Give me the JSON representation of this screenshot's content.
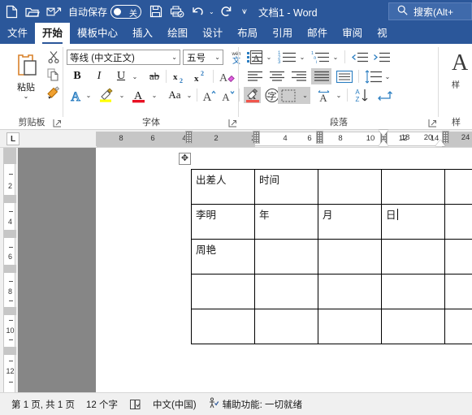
{
  "titlebar": {
    "quick_access": [
      {
        "name": "new-document-icon",
        "tip": "新建"
      },
      {
        "name": "open-folder-icon",
        "tip": "打开"
      },
      {
        "name": "email-attach-icon",
        "tip": "电子邮件"
      }
    ],
    "autosave_label": "自动保存",
    "autosave_state": "关",
    "quick_access_2": [
      {
        "name": "save-icon",
        "tip": "保存"
      },
      {
        "name": "print-preview-icon",
        "tip": "打印预览"
      },
      {
        "name": "undo-icon",
        "tip": "撤消"
      },
      {
        "name": "redo-icon",
        "tip": "恢复"
      },
      {
        "name": "customize-qat-icon",
        "tip": "自定义快速访问工具栏"
      }
    ],
    "document_title": "文档1  -  Word",
    "search_placeholder": "搜索(Alt+"
  },
  "tabs": [
    {
      "label": "文件",
      "active": false
    },
    {
      "label": "开始",
      "active": true
    },
    {
      "label": "模板中心",
      "active": false
    },
    {
      "label": "插入",
      "active": false
    },
    {
      "label": "绘图",
      "active": false
    },
    {
      "label": "设计",
      "active": false
    },
    {
      "label": "布局",
      "active": false
    },
    {
      "label": "引用",
      "active": false
    },
    {
      "label": "邮件",
      "active": false
    },
    {
      "label": "审阅",
      "active": false
    },
    {
      "label": "视",
      "active": false
    }
  ],
  "ribbon": {
    "clipboard": {
      "group_label": "剪贴板",
      "paste_label": "粘贴",
      "paste_caret": "⌄",
      "buttons": [
        {
          "name": "cut-button",
          "label": "剪切"
        },
        {
          "name": "copy-button",
          "label": "复制"
        },
        {
          "name": "format-painter-button",
          "label": "格式刷"
        }
      ]
    },
    "font": {
      "group_label": "字体",
      "font_name": "等线 (中文正文)",
      "font_size": "五号",
      "buttons": [
        {
          "name": "phonetic-guide-button",
          "label": "拼音指南"
        },
        {
          "name": "enclose-characters-button",
          "label": "字符边框"
        },
        {
          "name": "bold-button",
          "label": "B"
        },
        {
          "name": "italic-button",
          "label": "I"
        },
        {
          "name": "underline-button",
          "label": "U"
        },
        {
          "name": "strikethrough-button",
          "label": "ab"
        },
        {
          "name": "subscript-button",
          "label": "x₂"
        },
        {
          "name": "superscript-button",
          "label": "x²"
        },
        {
          "name": "clear-format-button",
          "label": "清除所有格式"
        },
        {
          "name": "text-effects-button",
          "label": "文本效果"
        },
        {
          "name": "highlight-color-button",
          "label": "突出显示"
        },
        {
          "name": "font-color-button",
          "label": "字体颜色"
        },
        {
          "name": "change-case-button",
          "label": "Aa"
        },
        {
          "name": "grow-font-button",
          "label": "增大字号"
        },
        {
          "name": "shrink-font-button",
          "label": "减小字号"
        },
        {
          "name": "character-shading-button",
          "label": "字符底纹"
        },
        {
          "name": "circle-character-button",
          "label": "带圈字符"
        }
      ]
    },
    "paragraph": {
      "group_label": "段落",
      "buttons": [
        {
          "name": "bullets-button",
          "label": "项目符号"
        },
        {
          "name": "numbering-button",
          "label": "编号"
        },
        {
          "name": "multilevel-list-button",
          "label": "多级列表"
        },
        {
          "name": "decrease-indent-button",
          "label": "减少缩进量"
        },
        {
          "name": "increase-indent-button",
          "label": "增加缩进量"
        },
        {
          "name": "align-left-button",
          "label": "左对齐"
        },
        {
          "name": "align-center-button",
          "label": "居中"
        },
        {
          "name": "align-right-button",
          "label": "右对齐"
        },
        {
          "name": "justify-button",
          "label": "两端对齐"
        },
        {
          "name": "distribute-button",
          "label": "分散对齐"
        },
        {
          "name": "line-spacing-button",
          "label": "行和段落间距"
        },
        {
          "name": "shading-button",
          "label": "底纹"
        },
        {
          "name": "borders-button",
          "label": "边框"
        },
        {
          "name": "adjust-list-indent-button",
          "label": "中文版式"
        },
        {
          "name": "sort-button",
          "label": "排序"
        },
        {
          "name": "show-marks-button",
          "label": "显示编辑标记"
        }
      ]
    },
    "styles": {
      "group_label": "样",
      "gallery_label": "样"
    }
  },
  "hruler": {
    "tab_stop_marker": "L",
    "numbers": [
      "8",
      "6",
      "4",
      "2",
      "2",
      "4",
      "6",
      "8",
      "10",
      "12",
      "14",
      "16",
      "18",
      "20",
      "24"
    ]
  },
  "vruler": {
    "numbers": [
      "2",
      "4",
      "6",
      "8",
      "10",
      "12"
    ]
  },
  "document": {
    "move_handle_icon": "✥",
    "table": {
      "rows": [
        [
          "出差人",
          "时间",
          "",
          "",
          ""
        ],
        [
          "李明",
          "年",
          "月",
          "日",
          ""
        ],
        [
          "周艳",
          "",
          "",
          "",
          ""
        ],
        [
          "",
          "",
          "",
          "",
          ""
        ],
        [
          "",
          "",
          "",
          "",
          ""
        ]
      ],
      "cursor_cell": {
        "row": 1,
        "col": 3
      }
    }
  },
  "statusbar": {
    "page_info": "第 1 页, 共 1 页",
    "word_count": "12 个字",
    "proofing_icon": "proofing-icon",
    "language": "中文(中国)",
    "accessibility": "辅助功能: 一切就绪"
  }
}
